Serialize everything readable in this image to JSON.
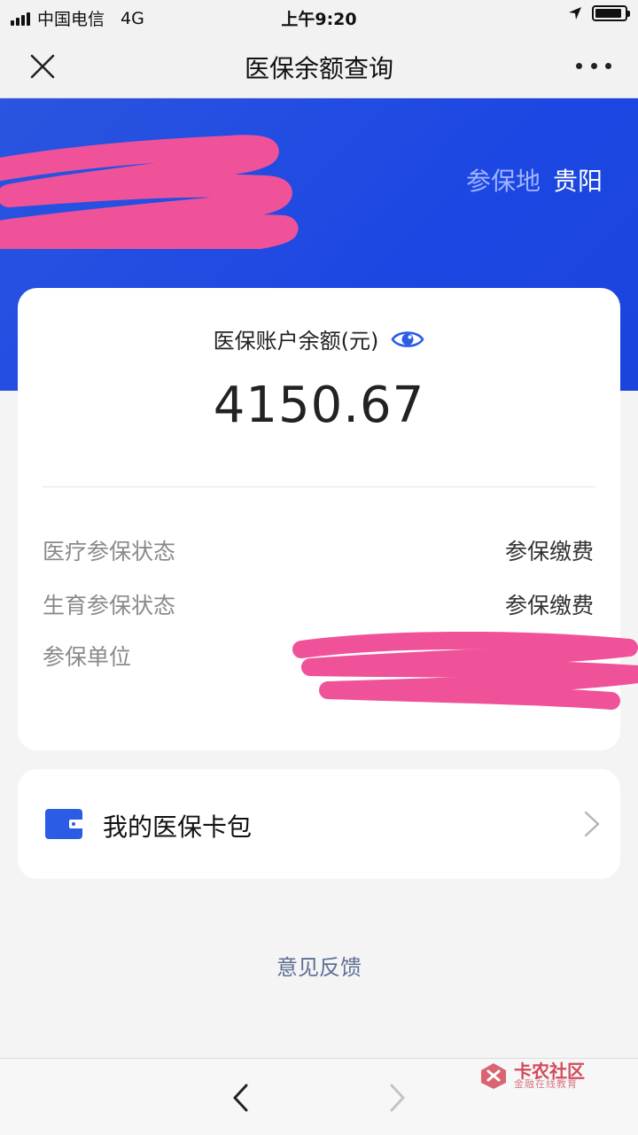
{
  "status_bar": {
    "carrier": "中国电信",
    "network": "4G",
    "time": "上午9:20",
    "battery_level": 0.9
  },
  "nav": {
    "title": "医保余额查询",
    "close_icon": "close-icon",
    "more_icon": "more-icon"
  },
  "banner": {
    "insured_place_label": "参保地",
    "insured_place_value": "贵阳"
  },
  "balance": {
    "title": "医保账户余额(元)",
    "amount": "4150.67",
    "rows": [
      {
        "label": "医疗参保状态",
        "value": "参保缴费"
      },
      {
        "label": "生育参保状态",
        "value": "参保缴费"
      },
      {
        "label": "参保单位",
        "value": ""
      }
    ]
  },
  "wallet": {
    "label": "我的医保卡包"
  },
  "feedback": {
    "label": "意见反馈"
  },
  "watermark": {
    "title": "卡农社区",
    "subtitle": "金融在线教育"
  },
  "colors": {
    "accent": "#1d47e2",
    "wallet_icon": "#2b5ce6",
    "redaction": "#f0529a"
  }
}
